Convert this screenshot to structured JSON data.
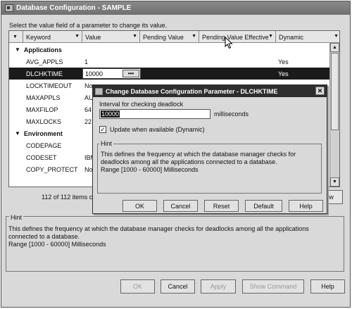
{
  "window": {
    "title": "Database Configuration - SAMPLE"
  },
  "instruction": "Select the value field of a parameter to change its value.",
  "table": {
    "columns": [
      "Keyword",
      "Value",
      "Pending Value",
      "Pending Value Effective",
      "Dynamic"
    ],
    "rows": [
      {
        "type": "group",
        "keyword": "Applications"
      },
      {
        "keyword": "AVG_APPLS",
        "value": "1",
        "dynamic": "Yes"
      },
      {
        "keyword": "DLCHKTIME",
        "value": "10000",
        "dynamic": "Yes",
        "selected": true
      },
      {
        "keyword": "LOCKTIMEOUT",
        "value": "No",
        "dynamic": ""
      },
      {
        "keyword": "MAXAPPLS",
        "value": "AU",
        "dynamic": ""
      },
      {
        "keyword": "MAXFILOP",
        "value": "64",
        "dynamic": ""
      },
      {
        "keyword": "MAXLOCKS",
        "value": "22",
        "dynamic": ""
      },
      {
        "type": "group",
        "keyword": "Environment"
      },
      {
        "keyword": "CODEPAGE",
        "value": "",
        "dynamic": ""
      },
      {
        "keyword": "CODESET",
        "value": "IBM",
        "dynamic": ""
      },
      {
        "keyword": "COPY_PROTECT",
        "value": "No",
        "dynamic": ""
      }
    ],
    "ellipsis": "•••",
    "count_text": "112 of 112 items c",
    "view_button": "w"
  },
  "hint": {
    "legend": "Hint",
    "text": "This defines the frequency at which the database manager checks for deadlocks among all the applications connected to a database.",
    "range": "Range [1000 - 60000] Milliseconds"
  },
  "buttons": {
    "ok": "OK",
    "cancel": "Cancel",
    "apply": "Apply",
    "show_command": "Show Command",
    "help": "Help"
  },
  "dialog": {
    "title": "Change Database Configuration Parameter - DLCHKTIME",
    "close": "✕",
    "field_label": "Interval for checking deadlock",
    "field_value": "10000",
    "unit": "milliseconds",
    "checkbox_checked": true,
    "checkbox_mark": "✓",
    "checkbox_label": "Update when available (Dynamic)",
    "hint_legend": "Hint",
    "hint_text": "This defines the frequency at which the database manager checks for deadlocks among all the applications connected to a database.",
    "hint_range": "Range [1000 - 60000] Milliseconds",
    "buttons": {
      "ok": "OK",
      "cancel": "Cancel",
      "reset": "Reset",
      "default": "Default",
      "help": "Help"
    }
  }
}
